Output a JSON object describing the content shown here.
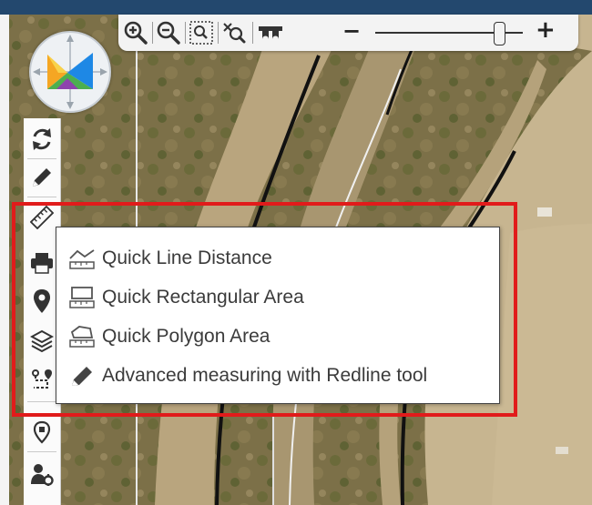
{
  "toolbar": {
    "zoom_in_icon": "zoom-in-icon",
    "zoom_out_icon": "zoom-out-icon",
    "zoom_box_icon": "zoom-box-icon",
    "clear_zoom_icon": "clear-zoom-icon",
    "binoculars_icon": "binoculars-icon",
    "zoom_minus_label": "−",
    "zoom_plus_label": "+",
    "zoom_slider_level": 0.84
  },
  "left_tools": [
    {
      "name": "refresh-icon"
    },
    {
      "name": "pencil-icon"
    },
    {
      "name": "ruler-icon"
    },
    {
      "name": "printer-icon"
    },
    {
      "name": "location-pin-icon"
    },
    {
      "name": "layers-icon"
    },
    {
      "name": "route-icon"
    },
    {
      "name": "bookmark-pin-icon"
    },
    {
      "name": "user-settings-icon"
    }
  ],
  "measure_menu": {
    "items": [
      {
        "label": "Quick Line Distance",
        "icon": "line-distance-icon"
      },
      {
        "label": "Quick Rectangular Area",
        "icon": "rectangle-area-icon"
      },
      {
        "label": "Quick Polygon Area",
        "icon": "polygon-area-icon"
      },
      {
        "label": "Advanced measuring with Redline tool",
        "icon": "pencil-icon"
      }
    ]
  },
  "colors": {
    "highlight": "#e11b1b",
    "topbar": "#23486e"
  }
}
